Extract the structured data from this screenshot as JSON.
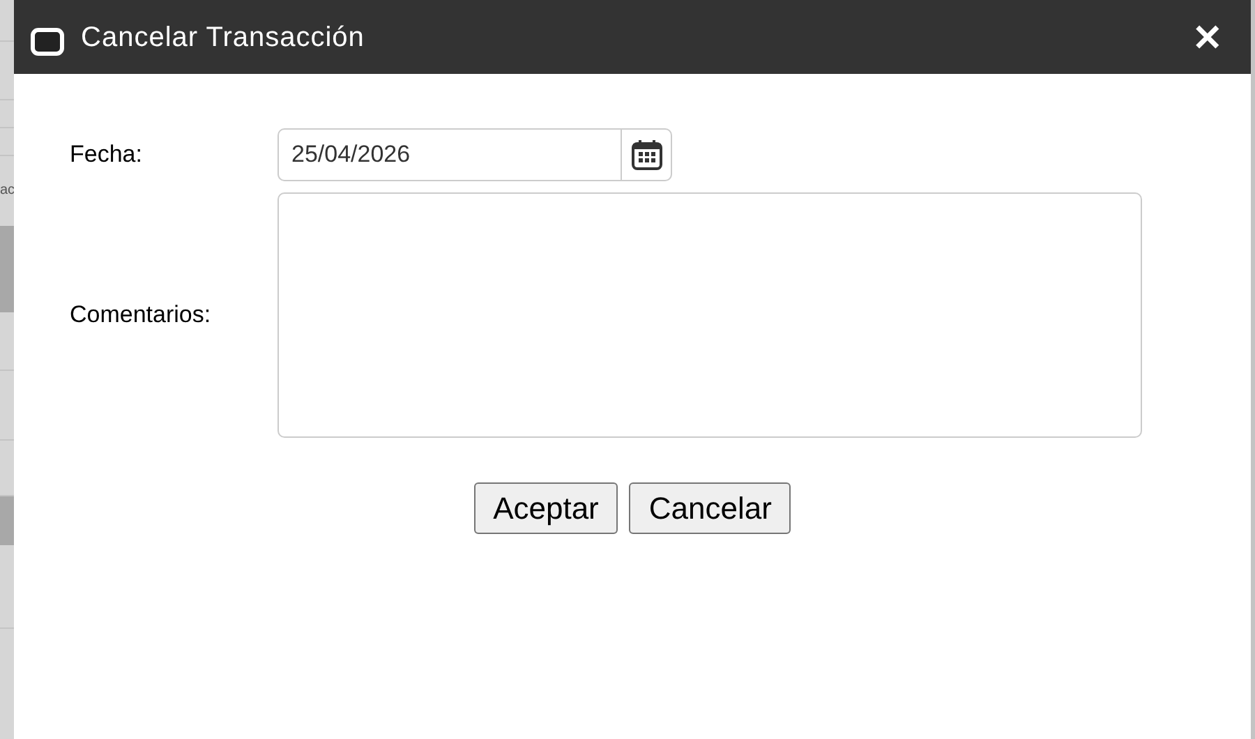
{
  "backdrop": {
    "text_fragment": "ac"
  },
  "dialog": {
    "title": "Cancelar Transacción",
    "close": "✕",
    "fields": [
      {
        "kind": "date",
        "label": "Fecha:",
        "value": "25/04/2026"
      },
      {
        "kind": "textarea",
        "label": "Comentarios:"
      }
    ],
    "buttons": [
      "Aceptar",
      "Cancelar"
    ]
  }
}
